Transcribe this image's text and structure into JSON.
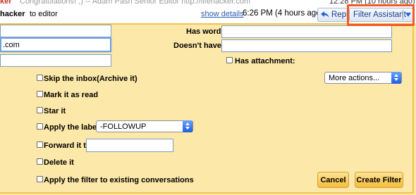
{
  "top_strip": {
    "from_fragment": "ker",
    "preview": "Congratulations! ;) -- Adam Pash Senior Editor http://lifehacker.com",
    "time": "12:28 PM (10 hours ago)"
  },
  "message": {
    "sender": "hacker",
    "recipient_text": "to editor",
    "show_details_label": "show details",
    "time": "6:26 PM (4 hours ago)",
    "reply_label": "Reply",
    "filter_assistant_label": "Filter Assistant"
  },
  "filter_form": {
    "from_value": "",
    "to_value": ".com",
    "subject_value": "",
    "has_words_label": "Has word:",
    "has_words_value": "",
    "doesnt_have_label": "Doesn't have:",
    "doesnt_have_value": "",
    "has_attachment_label": "Has attachment:"
  },
  "actions": {
    "more_actions_label": "More actions...",
    "skip_inbox_label": "Skip the inbox(Archive it)",
    "mark_read_label": "Mark it as read",
    "star_label": "Star it",
    "apply_label_label": "Apply the label",
    "label_select_value": "-FOLLOWUP",
    "forward_label": "Forward it to",
    "forward_value": "",
    "delete_label": "Delete it",
    "apply_existing_label": "Apply the filter to existing conversations",
    "cancel_label": "Cancel",
    "create_filter_label": "Create Filter"
  },
  "colors": {
    "panel_bg": "#fce8a9",
    "panel_border": "#f3c24c",
    "highlight": "#f15a24",
    "link": "#2a5db0"
  }
}
